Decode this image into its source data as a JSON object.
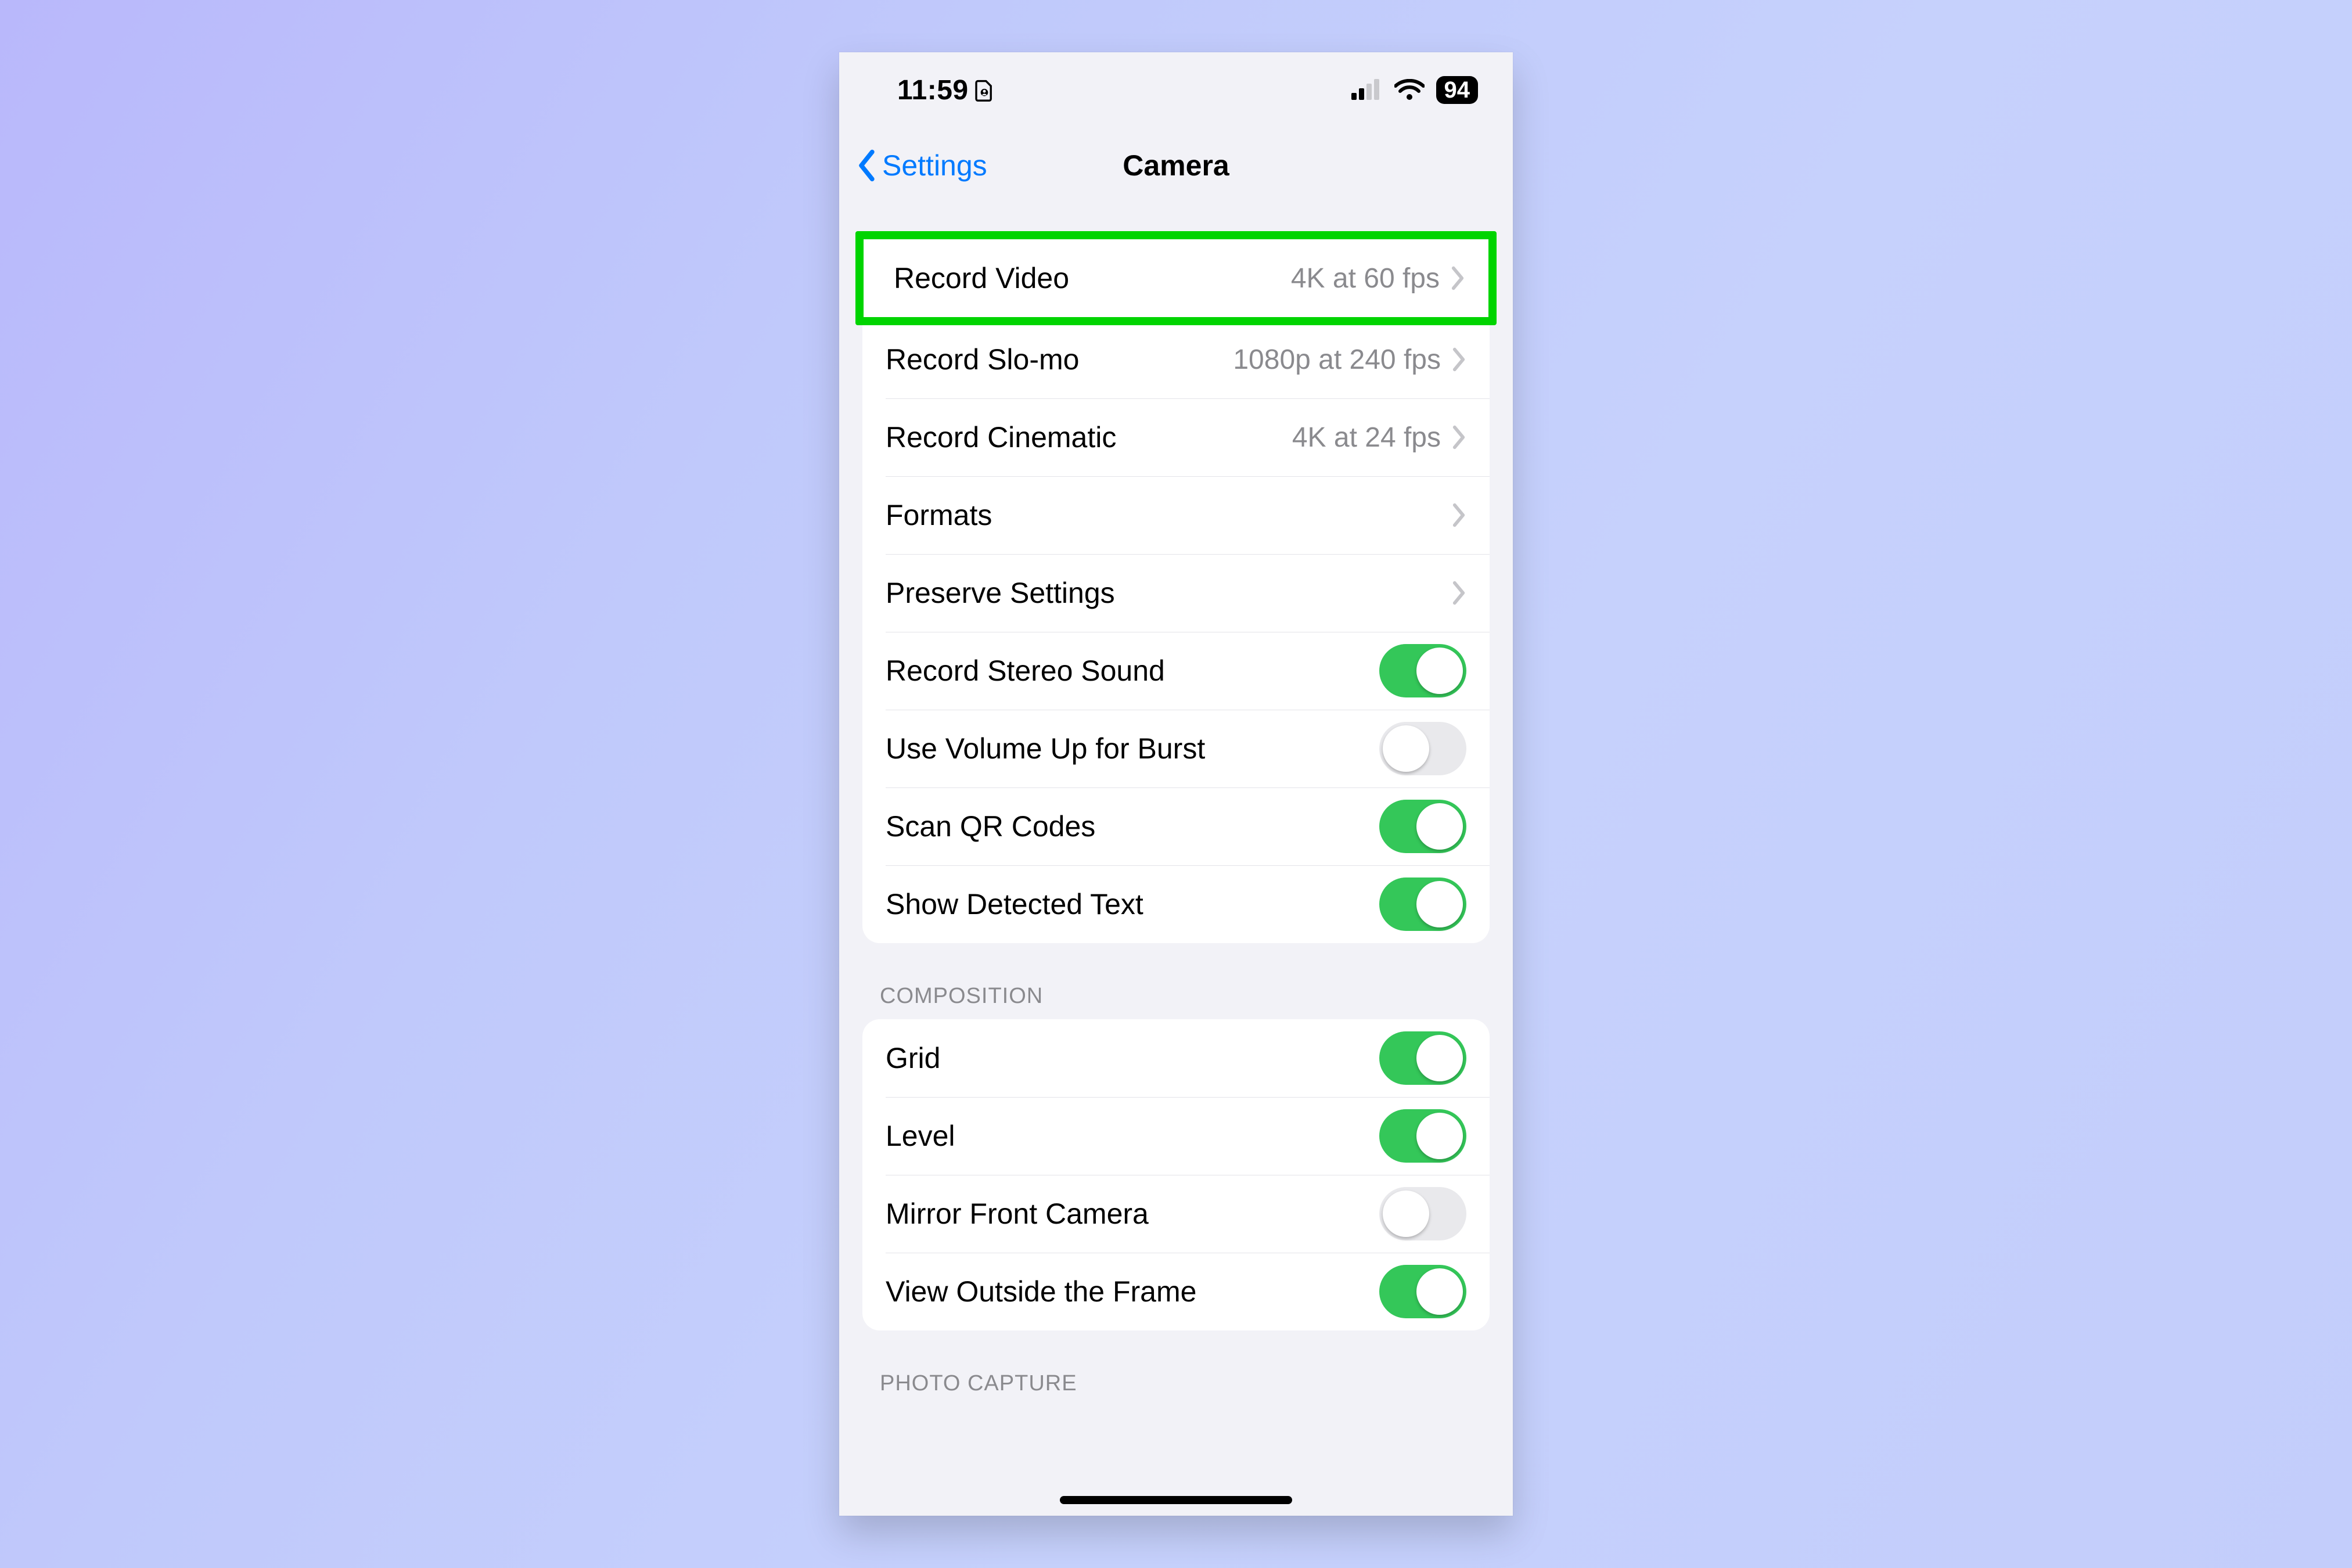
{
  "status": {
    "time": "11:59",
    "battery_percent": "94"
  },
  "nav": {
    "back_label": "Settings",
    "title": "Camera"
  },
  "sections": {
    "main": {
      "rows": [
        {
          "key": "record_video",
          "label": "Record Video",
          "value": "4K at 60 fps",
          "type": "disclosure",
          "highlighted": true
        },
        {
          "key": "record_slomo",
          "label": "Record Slo-mo",
          "value": "1080p at 240 fps",
          "type": "disclosure"
        },
        {
          "key": "record_cinematic",
          "label": "Record Cinematic",
          "value": "4K at 24 fps",
          "type": "disclosure"
        },
        {
          "key": "formats",
          "label": "Formats",
          "value": "",
          "type": "disclosure"
        },
        {
          "key": "preserve_settings",
          "label": "Preserve Settings",
          "value": "",
          "type": "disclosure"
        },
        {
          "key": "record_stereo",
          "label": "Record Stereo Sound",
          "type": "toggle",
          "on": true
        },
        {
          "key": "volume_burst",
          "label": "Use Volume Up for Burst",
          "type": "toggle",
          "on": false
        },
        {
          "key": "scan_qr",
          "label": "Scan QR Codes",
          "type": "toggle",
          "on": true
        },
        {
          "key": "show_text",
          "label": "Show Detected Text",
          "type": "toggle",
          "on": true
        }
      ]
    },
    "composition": {
      "header": "COMPOSITION",
      "rows": [
        {
          "key": "grid",
          "label": "Grid",
          "type": "toggle",
          "on": true
        },
        {
          "key": "level",
          "label": "Level",
          "type": "toggle",
          "on": true
        },
        {
          "key": "mirror_front",
          "label": "Mirror Front Camera",
          "type": "toggle",
          "on": false
        },
        {
          "key": "view_outside",
          "label": "View Outside the Frame",
          "type": "toggle",
          "on": true
        }
      ]
    },
    "photo_capture": {
      "header": "PHOTO CAPTURE"
    }
  }
}
